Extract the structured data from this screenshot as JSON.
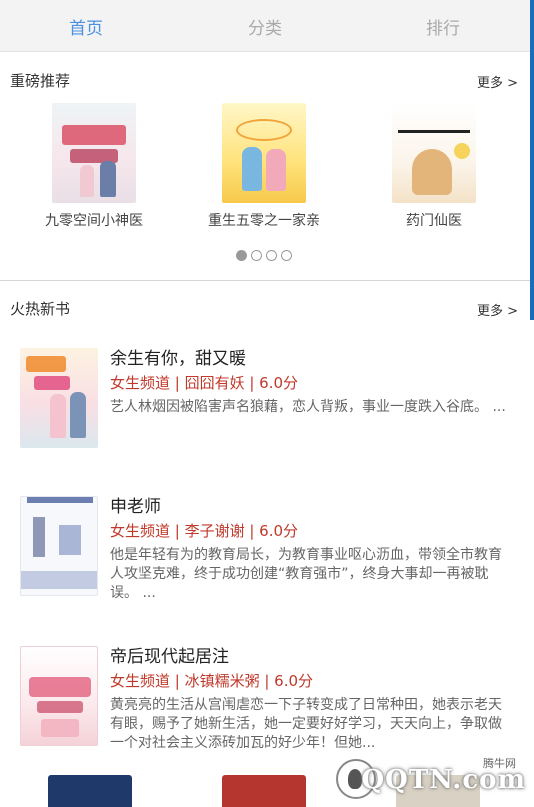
{
  "tabs": [
    {
      "label": "首页",
      "active": true
    },
    {
      "label": "分类",
      "active": false
    },
    {
      "label": "排行",
      "active": false
    }
  ],
  "featured": {
    "title": "重磅推荐",
    "more": "更多 >",
    "books": [
      {
        "name": "九零空间小神医"
      },
      {
        "name": "重生五零之一家亲"
      },
      {
        "name": "药门仙医"
      }
    ],
    "carousel": {
      "pages": 4,
      "current": 1
    }
  },
  "hot": {
    "title": "火热新书",
    "more": "更多 >",
    "books": [
      {
        "title": "余生有你，甜又暖",
        "meta": "女生频道 | 囧囧有妖 | 6.0分",
        "desc": "艺人林烟因被陷害声名狼藉，恋人背叛，事业一度跌入谷底。 ..."
      },
      {
        "title": "申老师",
        "meta": "女生频道 | 李子谢谢 | 6.0分",
        "desc": "他是年轻有为的教育局长，为教育事业呕心沥血，带领全市教育人攻坚克难，终于成功创建“教育强市”，终身大事却一再被耽误。 ..."
      },
      {
        "title": "帝后现代起居注",
        "meta": "女生频道 | 冰镇糯米粥 | 6.0分",
        "desc": "黄亮亮的生活从宫闱虐恋一下子转变成了日常种田，她表示老天有眼，赐予了她新生活，她一定要好好学习，天天向上，争取做一个对社会主义添砖加瓦的好少年！但她..."
      }
    ]
  },
  "watermark": {
    "small": "腾牛网",
    "big": "QQTN.com"
  },
  "colors": {
    "accent": "#4a90e2",
    "meta": "#c0392b",
    "tabbar": "#f3f3f3"
  }
}
